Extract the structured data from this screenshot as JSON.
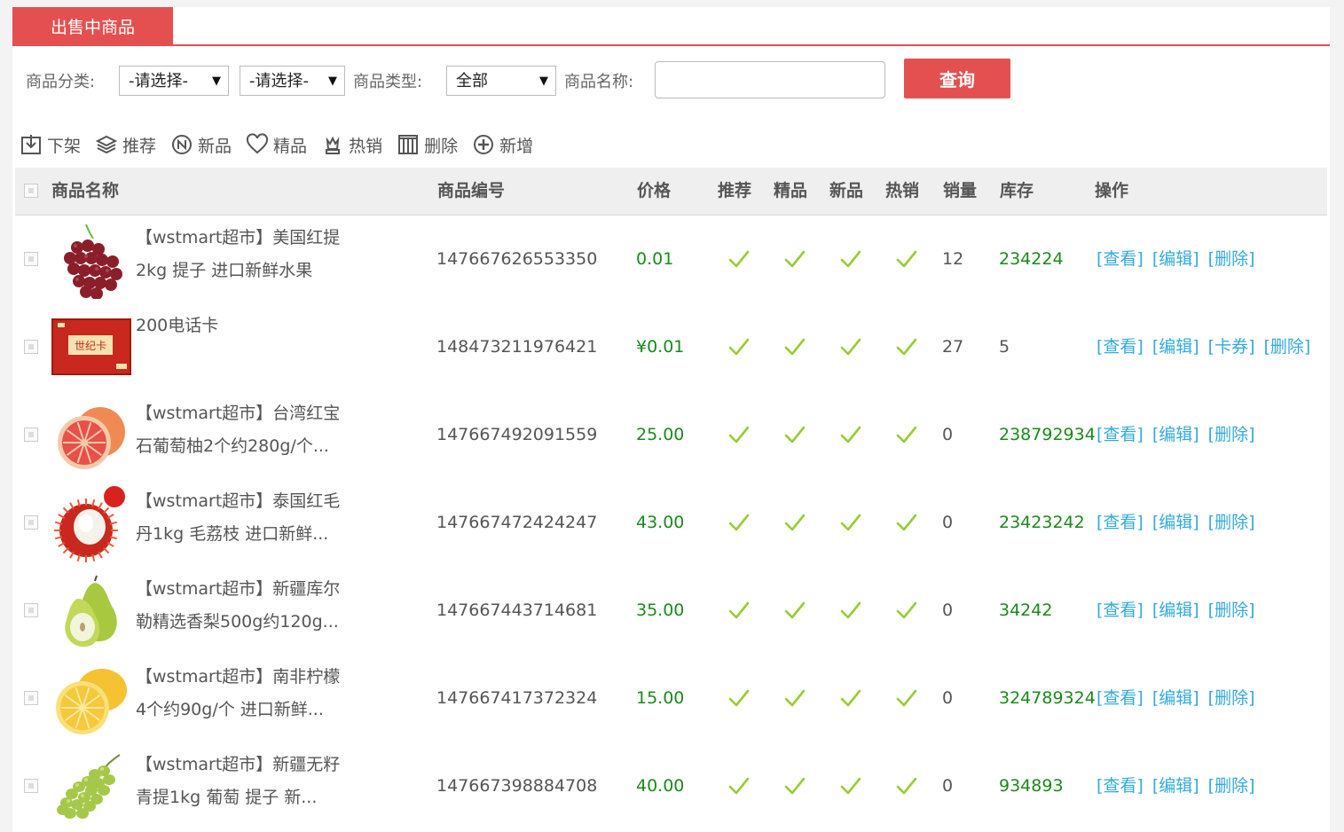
{
  "tab": {
    "label": "出售中商品"
  },
  "filters": {
    "category_label": "商品分类:",
    "category1_value": "-请选择-",
    "category2_value": "-请选择-",
    "type_label": "商品类型:",
    "type_value": "全部",
    "name_label": "商品名称:",
    "name_value": "",
    "query_label": "查询"
  },
  "toolbar": {
    "offshelf": "下架",
    "recommend": "推荐",
    "new": "新品",
    "best": "精品",
    "hot": "热销",
    "delete": "删除",
    "add": "新增"
  },
  "table": {
    "headers": {
      "name": "商品名称",
      "sn": "商品编号",
      "price": "价格",
      "recommend": "推荐",
      "best": "精品",
      "new": "新品",
      "hot": "热销",
      "sales": "销量",
      "stock": "库存",
      "ops": "操作"
    },
    "rows": [
      {
        "name1": "【wstmart超市】美国红提",
        "name2": "2kg 提子 进口新鲜水果",
        "sn": "147667626553350",
        "price": "0.01",
        "sales": "12",
        "stock": "234224",
        "ops": [
          "[查看]",
          "[编辑]",
          "[删除]"
        ],
        "image": "red-grapes-image"
      },
      {
        "name1": "200电话卡",
        "name2": "",
        "sn": "148473211976421",
        "price": "¥0.01",
        "sales": "27",
        "stock": "5",
        "ops": [
          "[查看]",
          "[编辑]",
          "[卡券]",
          "[删除]"
        ],
        "image": "phone-card-image"
      },
      {
        "name1": "【wstmart超市】台湾红宝",
        "name2": "石葡萄柚2个约280g/个...",
        "sn": "147667492091559",
        "price": "25.00",
        "sales": "0",
        "stock": "238792934",
        "ops": [
          "[查看]",
          "[编辑]",
          "[删除]"
        ],
        "image": "grapefruit-image"
      },
      {
        "name1": "【wstmart超市】泰国红毛",
        "name2": "丹1kg 毛荔枝 进口新鲜...",
        "sn": "147667472424247",
        "price": "43.00",
        "sales": "0",
        "stock": "23423242",
        "ops": [
          "[查看]",
          "[编辑]",
          "[删除]"
        ],
        "image": "rambutan-image"
      },
      {
        "name1": "【wstmart超市】新疆库尔",
        "name2": "勒精选香梨500g约120g...",
        "sn": "147667443714681",
        "price": "35.00",
        "sales": "0",
        "stock": "34242",
        "ops": [
          "[查看]",
          "[编辑]",
          "[删除]"
        ],
        "image": "pear-image"
      },
      {
        "name1": "【wstmart超市】南非柠檬",
        "name2": "4个约90g/个 进口新鲜...",
        "sn": "147667417372324",
        "price": "15.00",
        "sales": "0",
        "stock": "324789324",
        "ops": [
          "[查看]",
          "[编辑]",
          "[删除]"
        ],
        "image": "lemon-image"
      },
      {
        "name1": "【wstmart超市】新疆无籽",
        "name2": "青提1kg 葡萄 提子 新...",
        "sn": "147667398884708",
        "price": "40.00",
        "sales": "0",
        "stock": "934893",
        "ops": [
          "[查看]",
          "[编辑]",
          "[删除]"
        ],
        "image": "green-grapes-image"
      }
    ]
  },
  "colors": {
    "accent": "#e45050",
    "check": "#99cc33",
    "link": "#33aadd",
    "number_green": "#1a8a1a"
  },
  "card_logo_text": "世纪卡"
}
